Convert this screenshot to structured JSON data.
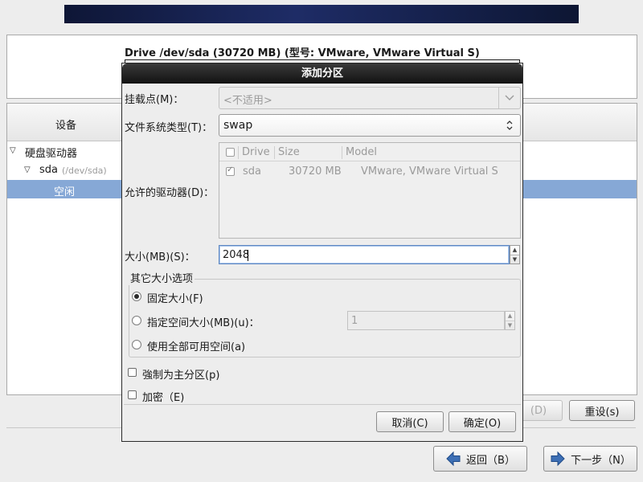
{
  "background": {
    "drive_title": "Drive /dev/sda (30720 MB) (型号: VMware, VMware Virtual S)",
    "tree": {
      "header_label": "设备",
      "items": [
        {
          "label": "硬盘驱动器",
          "sub": ""
        },
        {
          "label": "sda",
          "sub": "(/dev/sda)"
        },
        {
          "label": "空闲",
          "sub": ""
        }
      ]
    },
    "buttons": {
      "delete_label": "(D)",
      "reset_label": "重设(s)",
      "back_label": "返回（B）",
      "next_label": "下一步（N）"
    }
  },
  "dialog": {
    "title": "添加分区",
    "mount_point": {
      "label": "挂载点(M)：",
      "value": "<不适用>"
    },
    "fs_type": {
      "label": "文件系统类型(T)：",
      "value": "swap"
    },
    "allowed_drives": {
      "label": "允许的驱动器(D)：",
      "columns": [
        "Drive",
        "Size",
        "Model"
      ],
      "rows": [
        {
          "checked": true,
          "drive": "sda",
          "size": "30720 MB",
          "model": "VMware, VMware Virtual S"
        }
      ]
    },
    "size": {
      "label": "大小(MB)(S)：",
      "value": "2048"
    },
    "other_size_options": {
      "title": "其它大小选项",
      "fixed_size": "固定大小(F)",
      "fill_up_to": "指定空间大小(MB)(u)：",
      "fill_up_to_value": "1",
      "fill_all": "使用全部可用空间(a)",
      "selected": "fixed_size"
    },
    "force_primary": {
      "label": "強制为主分区(p)",
      "checked": false
    },
    "encrypt": {
      "label": "加密（E)",
      "checked": false
    },
    "cancel_label": "取消(C)",
    "ok_label": "确定(O)"
  },
  "colors": {
    "selection": "#86a8d6",
    "titlebar": "#1a1a1a",
    "banner": "#1e2c66",
    "focus": "#5f88c2"
  }
}
